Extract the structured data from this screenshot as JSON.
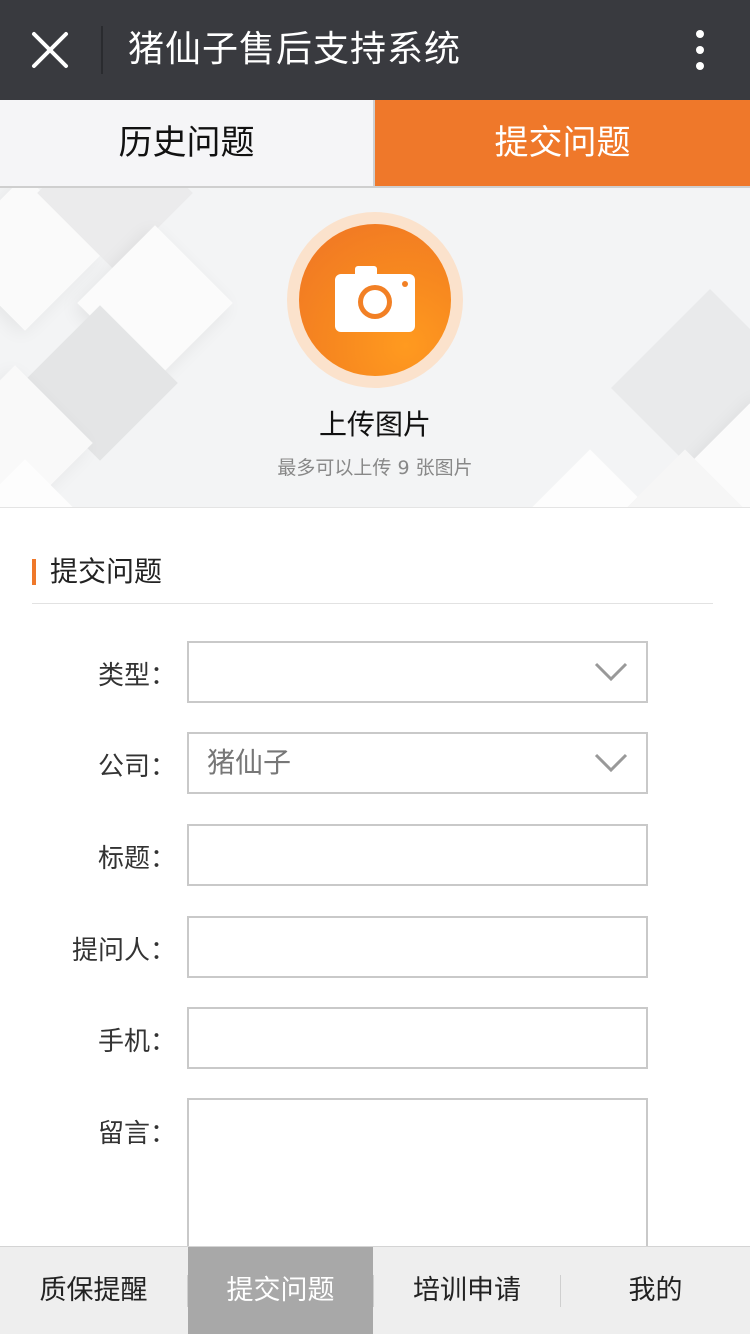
{
  "topbar": {
    "title": "猪仙子售后支持系统",
    "close_icon": "close-icon",
    "more_icon": "more-vertical-icon",
    "background": "#393a3f"
  },
  "tabs": [
    {
      "label": "历史问题",
      "active": false
    },
    {
      "label": "提交问题",
      "active": true
    }
  ],
  "accent_color": "#ef782a",
  "upload": {
    "icon": "camera-icon",
    "label": "上传图片",
    "hint": "最多可以上传 9 张图片"
  },
  "form": {
    "section_title": "提交问题",
    "fields": {
      "type": {
        "label": "类型：",
        "value": ""
      },
      "company": {
        "label": "公司：",
        "value": "猪仙子"
      },
      "title": {
        "label": "标题：",
        "value": ""
      },
      "asker": {
        "label": "提问人：",
        "value": ""
      },
      "phone": {
        "label": "手机：",
        "value": ""
      },
      "message": {
        "label": "留言：",
        "value": ""
      }
    }
  },
  "bottom_nav": [
    {
      "label": "质保提醒",
      "active": false
    },
    {
      "label": "提交问题",
      "active": true
    },
    {
      "label": "培训申请",
      "active": false
    },
    {
      "label": "我的",
      "active": false
    }
  ]
}
